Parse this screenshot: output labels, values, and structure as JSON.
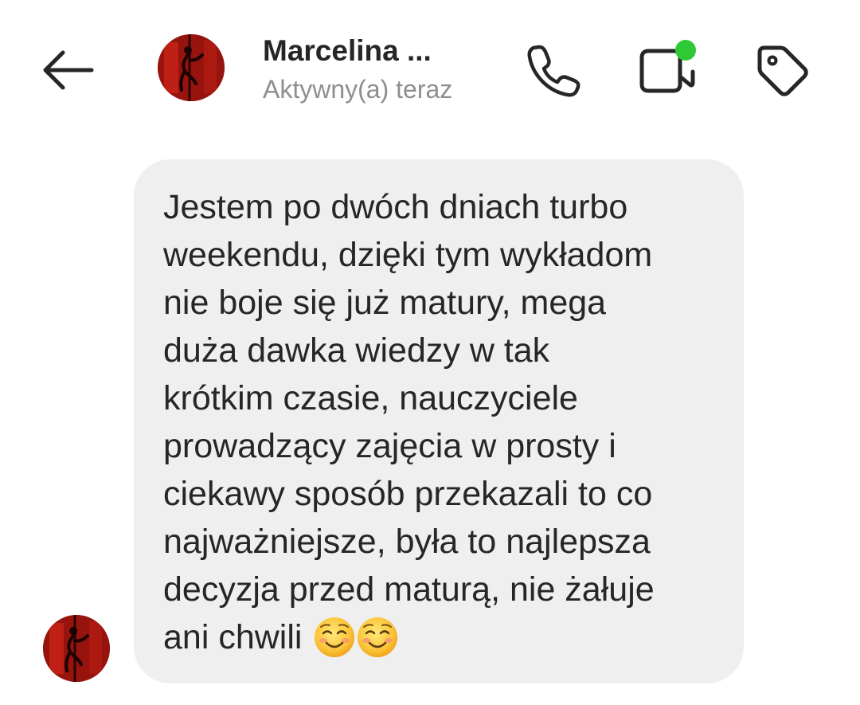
{
  "header": {
    "contact_name": "Marcelina ...",
    "status": "Aktywny(a) teraz",
    "online_indicator_color": "#2fc936"
  },
  "icons": {
    "back": "arrow-left-icon",
    "call": "phone-icon",
    "video": "video-camera-icon",
    "tag": "tag-icon",
    "emoji": "smiling-face-with-smiling-eyes-icon"
  },
  "message": {
    "text": "Jestem po dwóch dniach turbo\nweekendu, dzięki tym wykładom\nnie boje się już matury, mega\nduża dawka wiedzy w tak\nkrótkim czasie, nauczyciele\nprowadzący zajęcia w prosty i\nciekawy sposób przekazali to co\nnajważniejsze, była to najlepsza\ndecyzja przed maturą, nie żałuje\nani chwili ",
    "emoji": "☺️☺️",
    "bubble_color": "#efefef"
  }
}
